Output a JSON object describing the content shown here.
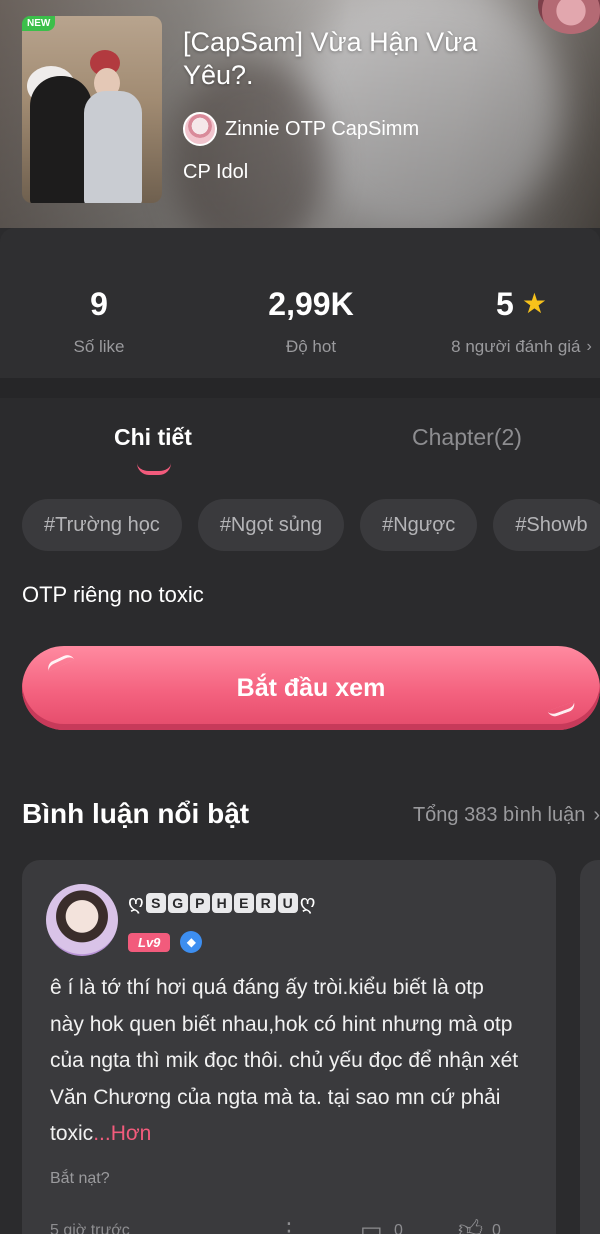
{
  "header": {
    "new_badge": "NEW",
    "title": "[CapSam] Vừa Hận Vừa Yêu?.",
    "author": "Zinnie OTP CapSimm",
    "category": "CP Idol"
  },
  "stats": [
    {
      "value": "9",
      "label": "Số like"
    },
    {
      "value": "2,99K",
      "label": "Độ hot"
    },
    {
      "value": "5",
      "label": "8 người đánh giá"
    }
  ],
  "tabs": [
    {
      "label": "Chi tiết",
      "active": true
    },
    {
      "label": "Chapter(2)",
      "active": false
    }
  ],
  "tags": [
    "#Trường học",
    "#Ngọt sủng",
    "#Ngược",
    "#Showb"
  ],
  "description": "OTP riêng no toxic",
  "start_button": "Bắt đầu xem",
  "comments": {
    "title": "Bình luận nổi bật",
    "total": "Tổng 383 bình luận",
    "items": [
      {
        "username_prefix": "ღ",
        "username_letters": [
          "S",
          "G",
          "P",
          "H",
          "E",
          "R",
          "U"
        ],
        "username_suffix": "ღ",
        "level": "Lv9",
        "text": "ê í là tớ thí hơi quá đáng ấy tròi.kiểu biết là otp này hok quen biết nhau,hok có hint nhưng mà otp của ngta thì mik đọc thôi. chủ yếu đọc để nhận xét Văn Chương của ngta mà ta. tại sao mn cứ phải toxic",
        "more": "...Hơn",
        "tag": "Bắt nạt?",
        "time": "5 giờ trước",
        "replies": "0",
        "likes": "0"
      }
    ]
  },
  "colors": {
    "accent": "#f25b7c",
    "background": "#2b2b2d",
    "card": "#3a3a3d",
    "star": "#f7c21b"
  },
  "icons": [
    "star-icon",
    "chevron-right-icon",
    "gem-icon",
    "more-icon",
    "comment-icon",
    "like-icon"
  ]
}
